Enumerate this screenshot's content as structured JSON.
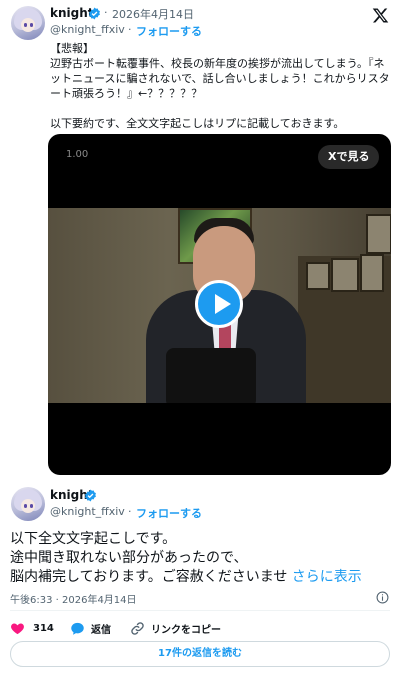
{
  "tweet1": {
    "name": "knight",
    "date": "2026年4月14日",
    "handle": "@knight_ffxiv",
    "separator": "·",
    "follow_label": "フォローする",
    "text_lines": [
      "【悲報】",
      "辺野古ボート転覆事件、校長の新年度の挨拶が流出してしまう。『ネ",
      "ットニュースに騙されないで、話し合いしましょう！これからリスタ",
      "ート頑張ろう！』←？？？？？",
      "",
      "以下要約です、全文文字起こしはリプに記載しておきます。"
    ],
    "video": {
      "speed": "1.00",
      "view_on_x_label": "Xで見る"
    }
  },
  "tweet2": {
    "name": "knight",
    "handle": "@knight_ffxiv",
    "separator": "·",
    "follow_label": "フォローする",
    "text_lines": [
      "以下全文文字起こしです。",
      "途中聞き取れない部分があったので、",
      "脳内補完しております。ご容赦くださいませ"
    ],
    "show_more_label": "さらに表示",
    "timestamp": "午後6:33 · 2026年4月14日",
    "likes_count": "314",
    "reply_label": "返信",
    "copy_link_label": "リンクをコピー",
    "read_replies_label": "17件の返信を読む"
  },
  "colors": {
    "accent": "#1d9bf0",
    "like": "#f91880",
    "text": "#0f1419",
    "muted": "#536471"
  },
  "icons": [
    "x-logo-icon",
    "verified-badge-icon",
    "play-icon",
    "info-icon",
    "heart-icon",
    "reply-icon",
    "link-icon"
  ]
}
